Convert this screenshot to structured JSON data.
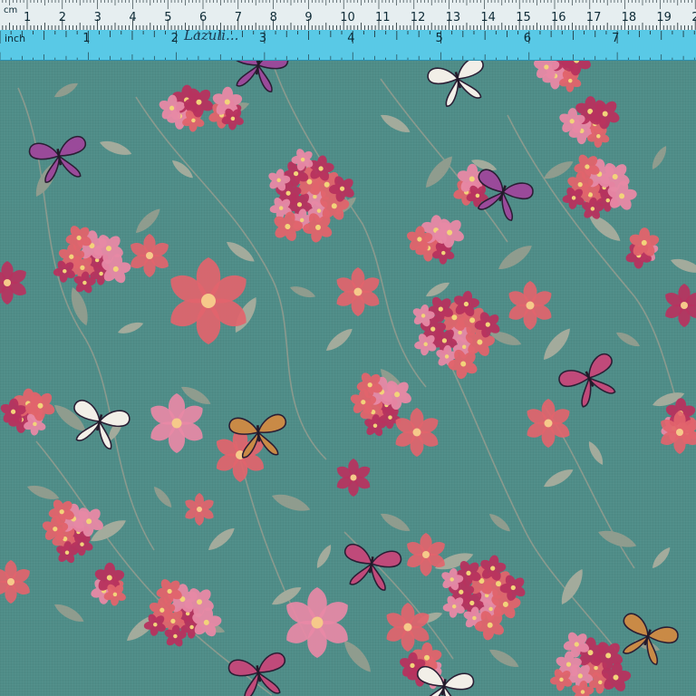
{
  "ruler": {
    "cm_label": "cm",
    "inch_label": "inch",
    "handwritten_note": "Lazuli...",
    "cm_numbers": [
      "1",
      "2",
      "3",
      "4",
      "5",
      "6",
      "7",
      "8",
      "9",
      "10",
      "11",
      "12",
      "13",
      "14",
      "15",
      "16",
      "17",
      "18",
      "19",
      "2"
    ],
    "inch_numbers": [
      "1",
      "2",
      "3",
      "4",
      "5",
      "6",
      "7"
    ]
  },
  "fabric": {
    "background_color": "#4f8d88",
    "flower_color_coral": "#e2646c",
    "flower_color_pink": "#e889a6",
    "flower_color_magenta": "#b8325e",
    "leaf_color": "#9fa898",
    "butterfly_colors": [
      "#9a4a9a",
      "#c98a46",
      "#f2efe8",
      "#c04a7a"
    ]
  }
}
